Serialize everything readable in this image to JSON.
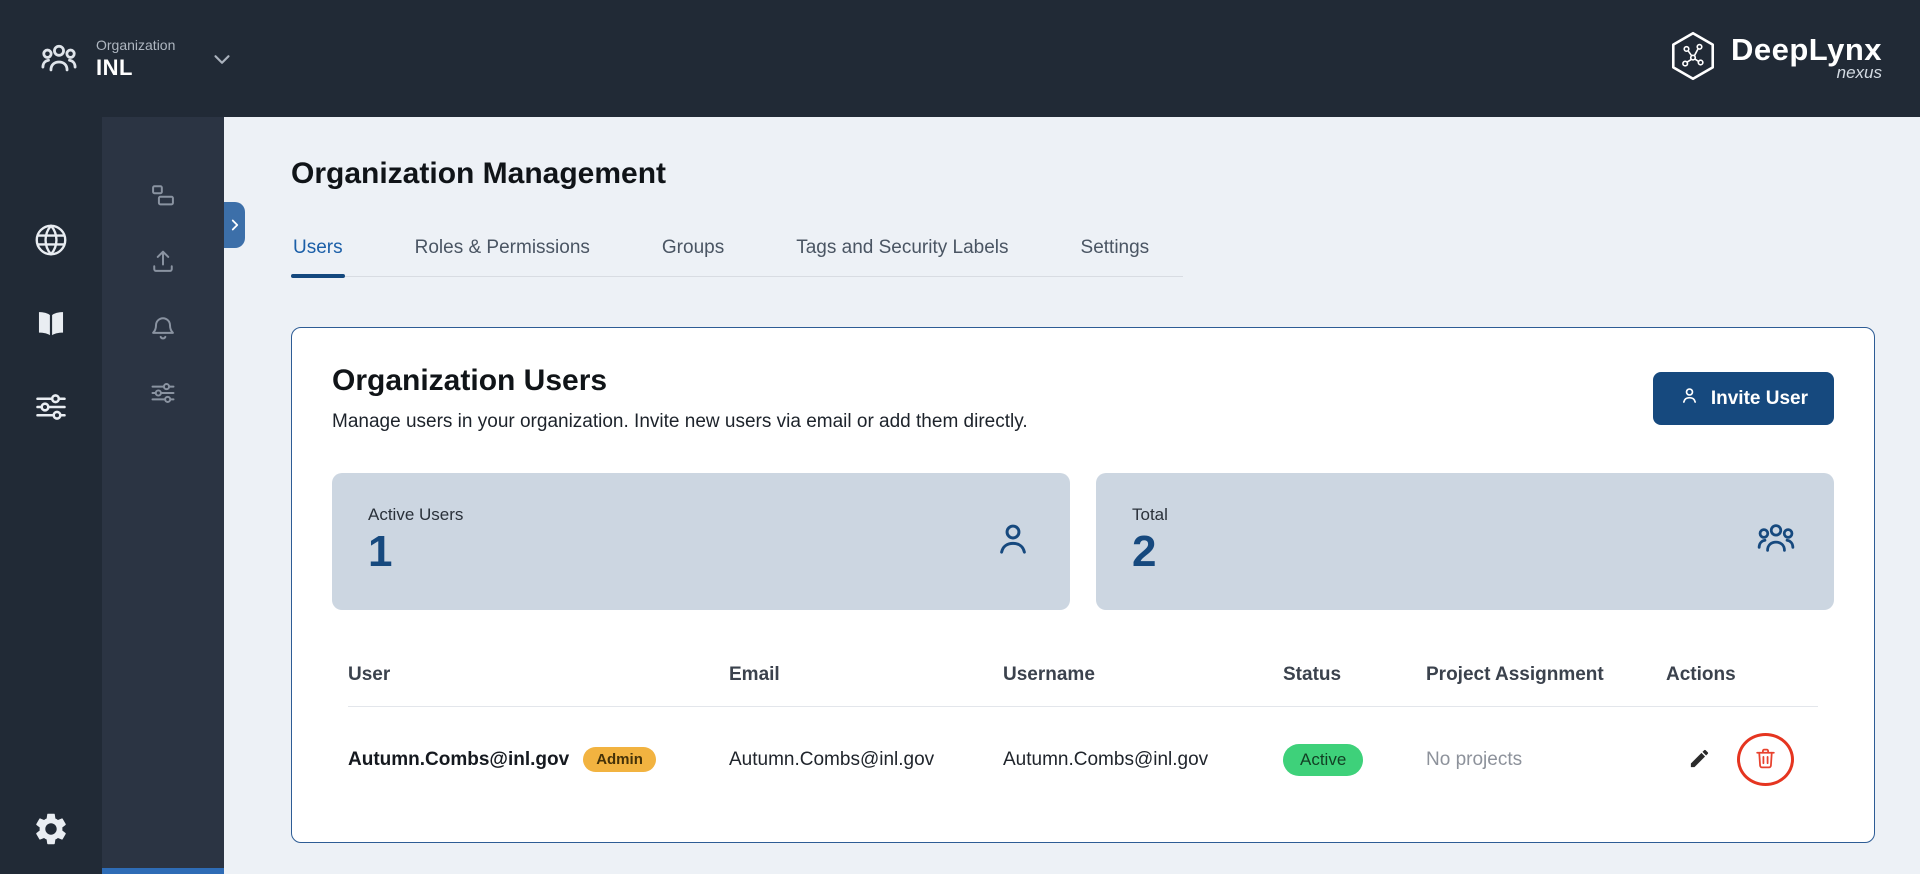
{
  "topbar": {
    "org_label": "Organization",
    "org_name": "INL",
    "brand": "DeepLynx",
    "brand_sub": "nexus"
  },
  "page": {
    "title": "Organization Management",
    "tabs": [
      {
        "label": "Users",
        "active": true
      },
      {
        "label": "Roles & Permissions",
        "active": false
      },
      {
        "label": "Groups",
        "active": false
      },
      {
        "label": "Tags and Security Labels",
        "active": false
      },
      {
        "label": "Settings",
        "active": false
      }
    ]
  },
  "users_card": {
    "title": "Organization Users",
    "subtitle": "Manage users in your organization. Invite new users via email or add them directly.",
    "invite_button_label": "Invite User",
    "stats": [
      {
        "label": "Active Users",
        "value": "1",
        "icon": "person-icon"
      },
      {
        "label": "Total",
        "value": "2",
        "icon": "people-icon"
      }
    ],
    "table": {
      "headers": {
        "user": "User",
        "email": "Email",
        "username": "Username",
        "status": "Status",
        "project": "Project Assignment",
        "actions": "Actions"
      },
      "rows": [
        {
          "user": "Autumn.Combs@inl.gov",
          "role_badge": "Admin",
          "email": "Autumn.Combs@inl.gov",
          "username": "Autumn.Combs@inl.gov",
          "status": "Active",
          "project": "No projects"
        }
      ]
    }
  },
  "icons": {
    "topbar": [
      "people-icon",
      "chevron-down-icon",
      "deeplynx-hexagon-logo"
    ],
    "rail": [
      "globe-icon",
      "book-icon",
      "sliders-icon",
      "gear-icon"
    ],
    "subrail": [
      "dashboard-icon",
      "upload-icon",
      "bell-icon",
      "tune-icon"
    ],
    "row_actions": [
      "edit-pencil-icon",
      "delete-trash-icon"
    ]
  },
  "colors": {
    "topbar_bg": "#212a36",
    "subrail_bg": "#2b3443",
    "main_bg": "#edf1f6",
    "accent_blue": "#16497e",
    "tab_active": "#1b5fa8",
    "stat_card_bg": "#ccd6e1",
    "admin_badge": "#f2b340",
    "active_badge": "#3ed17a",
    "annotation_red": "#e53520"
  }
}
